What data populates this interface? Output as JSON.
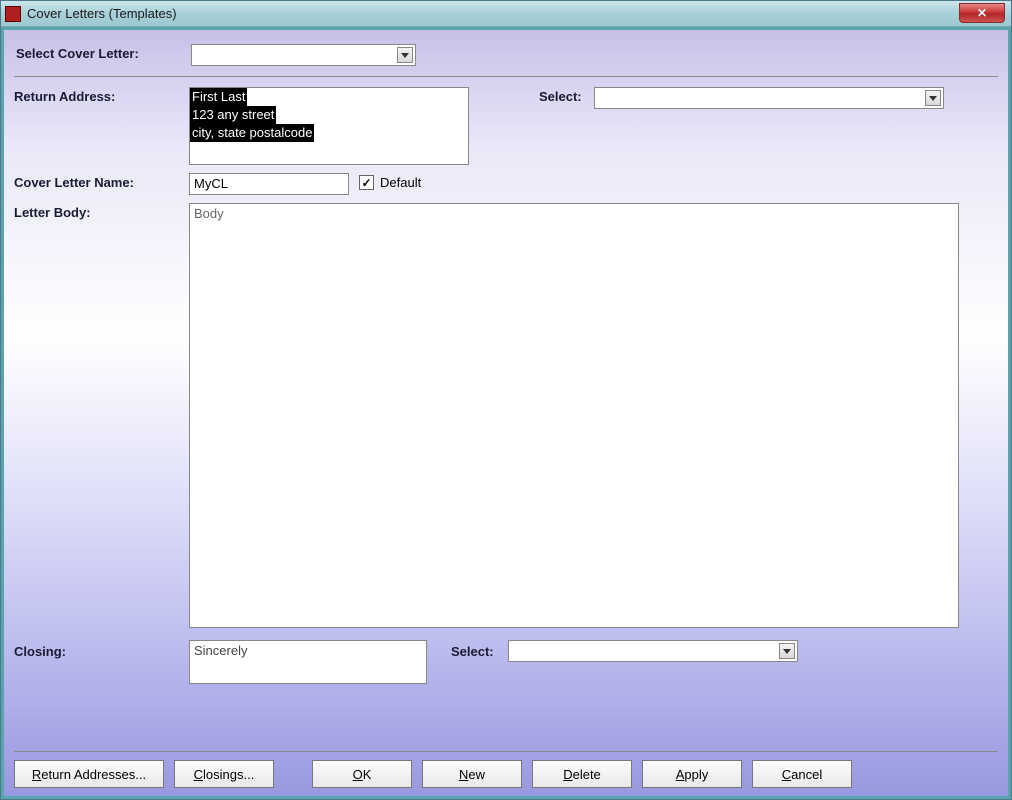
{
  "window": {
    "title": "Cover Letters (Templates)"
  },
  "top": {
    "select_cover_letter_label": "Select Cover Letter:",
    "select_cover_letter_value": ""
  },
  "form": {
    "return_address_label": "Return Address:",
    "return_address_lines": {
      "l1": "First Last",
      "l2": "123 any street",
      "l3": "city, state postalcode"
    },
    "select_label": "Select:",
    "select_value": "",
    "cover_letter_name_label": "Cover Letter Name:",
    "cover_letter_name_value": "MyCL",
    "default_checkbox_label": "Default",
    "default_checked": true,
    "letter_body_label": "Letter Body:",
    "letter_body_value": "Body",
    "closing_label": "Closing:",
    "closing_value": "Sincerely",
    "closing_select_label": "Select:",
    "closing_select_value": ""
  },
  "buttons": {
    "return_addresses": "eturn Addresses...",
    "return_addresses_accel": "R",
    "closings": "losings...",
    "closings_accel": "C",
    "ok": "K",
    "ok_accel": "O",
    "new": "ew",
    "new_accel": "N",
    "delete": "elete",
    "delete_accel": "D",
    "apply": "pply",
    "apply_accel": "A",
    "cancel": "ancel",
    "cancel_accel": "C"
  }
}
